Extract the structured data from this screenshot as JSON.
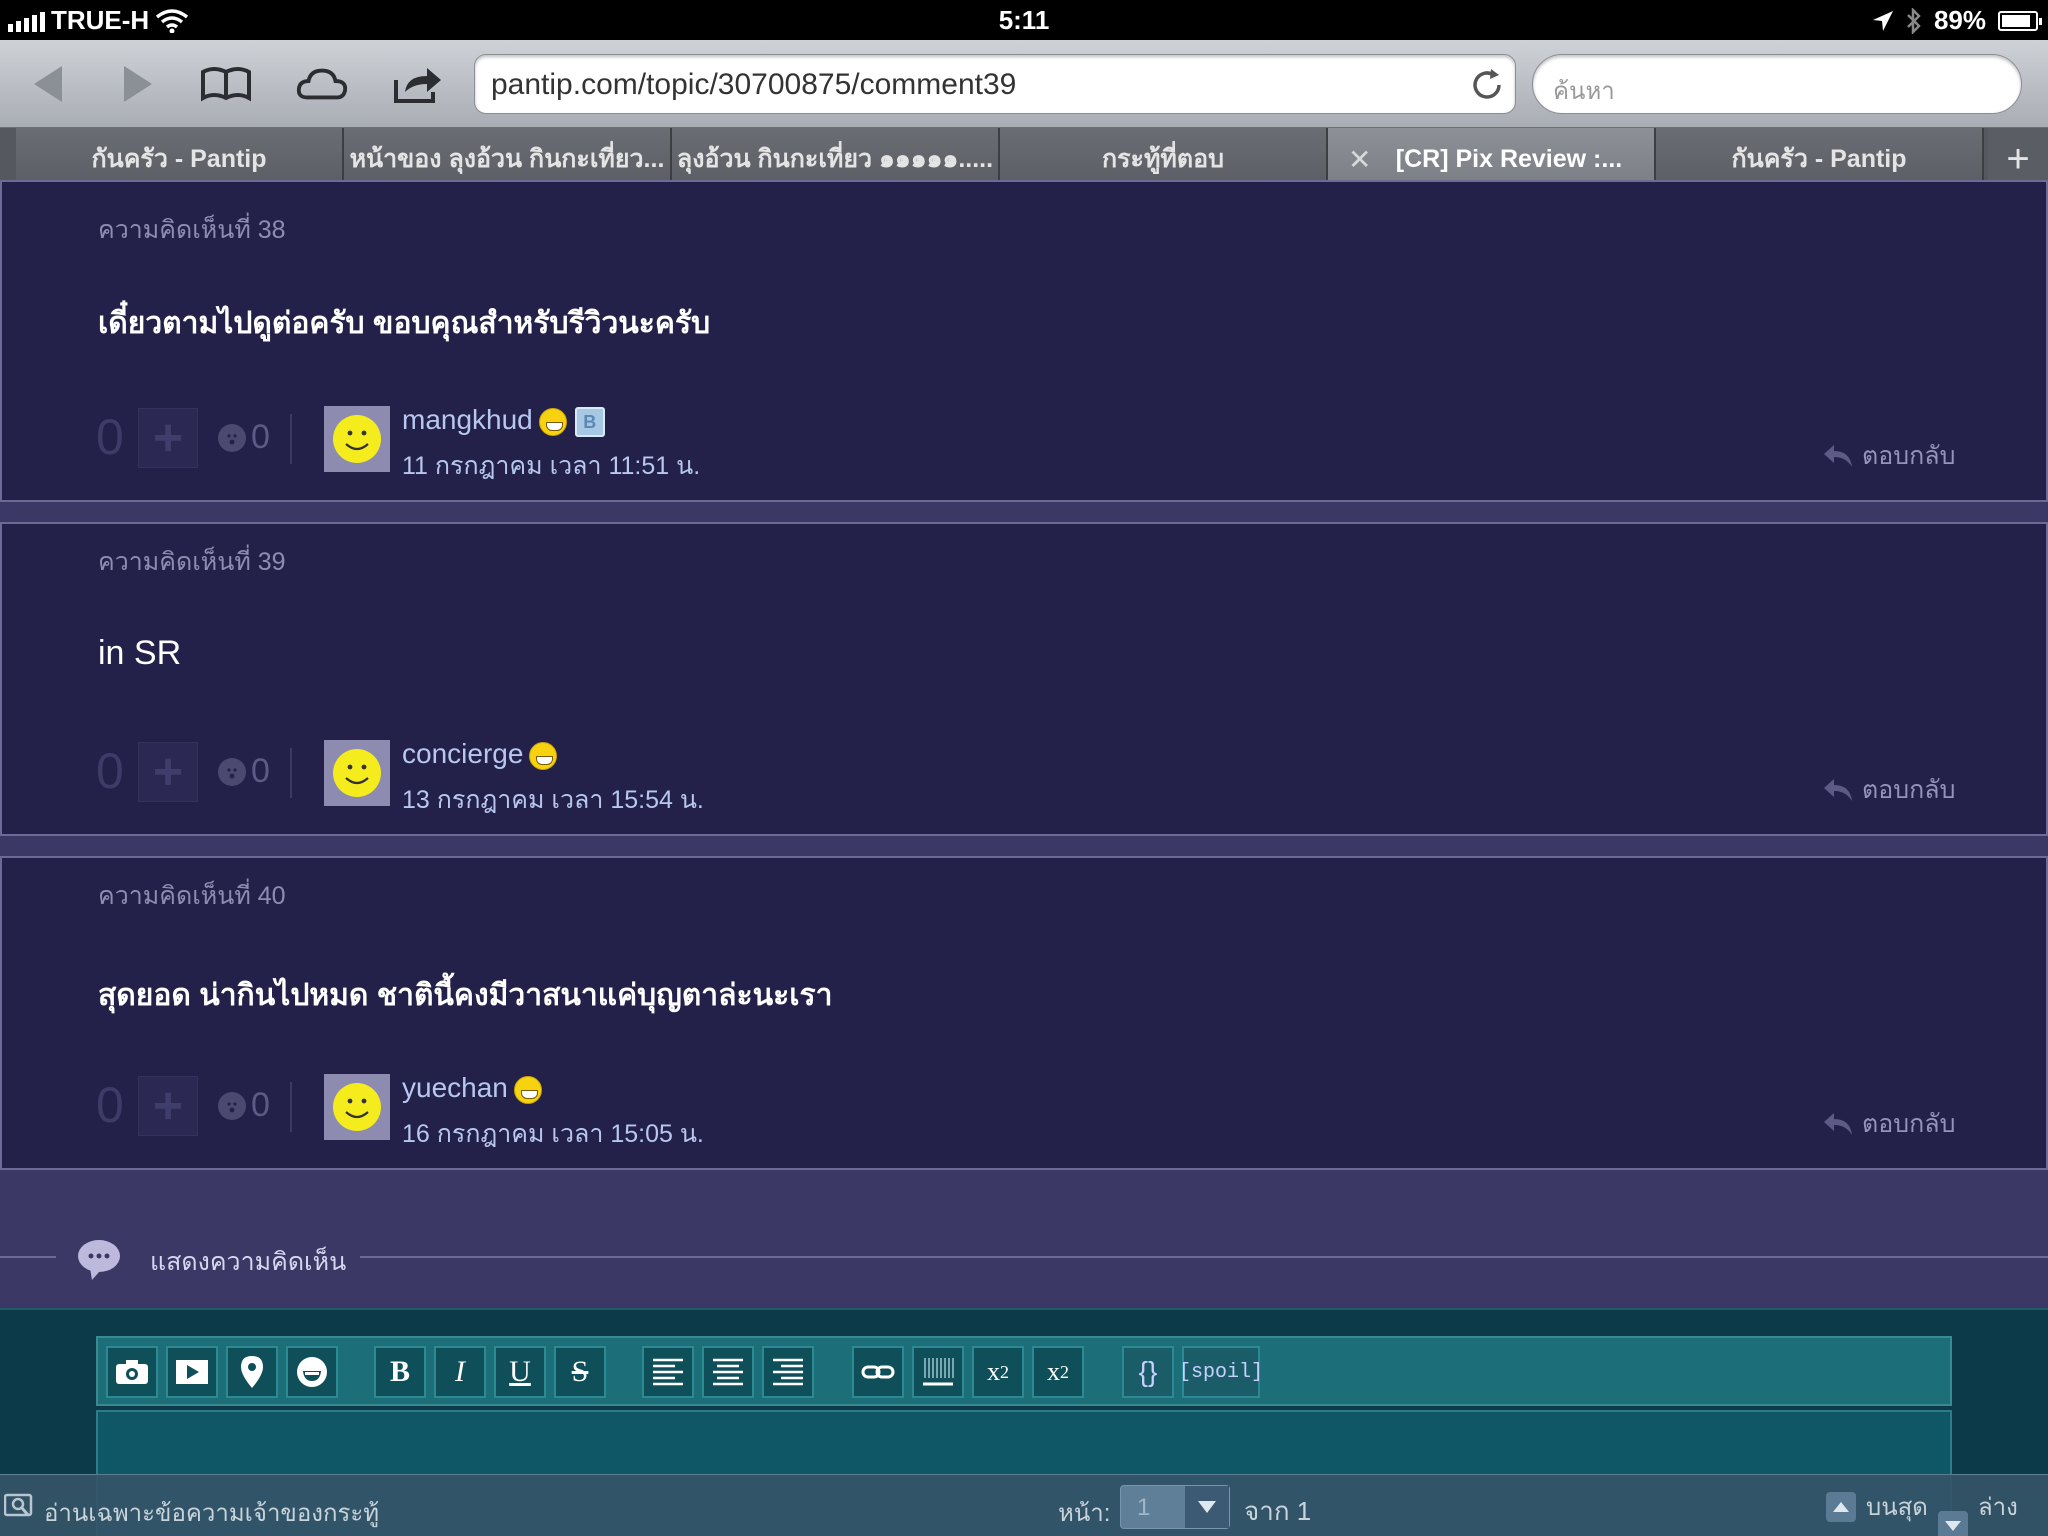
{
  "status_bar": {
    "carrier": "TRUE-H",
    "time": "5:11",
    "battery": "89%",
    "battery_level": 0.89
  },
  "browser": {
    "url": "pantip.com/topic/30700875/comment39",
    "search_placeholder": "ค้นหา",
    "tabs": [
      {
        "label": "กันครัว - Pantip",
        "active": false
      },
      {
        "label": "หน้าของ ลุงอ้วน กินกะเที่ยว...",
        "active": false
      },
      {
        "label": "ลุงอ้วน กินกะเที่ยว ๑๑๑๑๑.....",
        "active": false
      },
      {
        "label": "กระทู้ที่ตอบ",
        "active": false
      },
      {
        "label": "[CR] Pix Review :...",
        "active": true
      },
      {
        "label": "กันครัว - Pantip",
        "active": false
      }
    ],
    "add_tab": "+"
  },
  "comments": [
    {
      "title": "ความคิดเห็นที่ 38",
      "body": "เดี๋ยวตามไปดูต่อครับ ขอบคุณสำหรับรีวิวนะครับ",
      "votes": "0",
      "emotions": "0",
      "username": "mangkhud",
      "badge": "B",
      "date": "11 กรกฎาคม เวลา 11:51 น.",
      "reply": "ตอบกลับ"
    },
    {
      "title": "ความคิดเห็นที่ 39",
      "body": "in SR",
      "votes": "0",
      "emotions": "0",
      "username": "concierge",
      "date": "13 กรกฎาคม เวลา 15:54 น.",
      "reply": "ตอบกลับ"
    },
    {
      "title": "ความคิดเห็นที่ 40",
      "body": "สุดยอด น่ากินไปหมด ชาตินี้คงมีวาสนาแค่บุญตาล่ะนะเรา",
      "votes": "0",
      "emotions": "0",
      "username": "yuechan",
      "date": "16 กรกฎาคม เวลา 15:05 น.",
      "reply": "ตอบกลับ"
    }
  ],
  "show_comment": {
    "label": "แสดงความคิดเห็น"
  },
  "editor": {
    "buttons": {
      "bold": "B",
      "italic": "I",
      "underline": "U",
      "strike": "S",
      "superscript_base": "x",
      "superscript_exp": "2",
      "subscript_base": "x",
      "subscript_exp": "2",
      "code": "{}",
      "spoil": "[spoil]"
    }
  },
  "bottom_bar": {
    "owner_only": "อ่านเฉพาะข้อความเจ้าของกระทู้",
    "page_label": "หน้า:",
    "page_value": "1",
    "page_of": "จาก 1",
    "top": "บนสุด",
    "bottom": "ล่างสุด"
  }
}
